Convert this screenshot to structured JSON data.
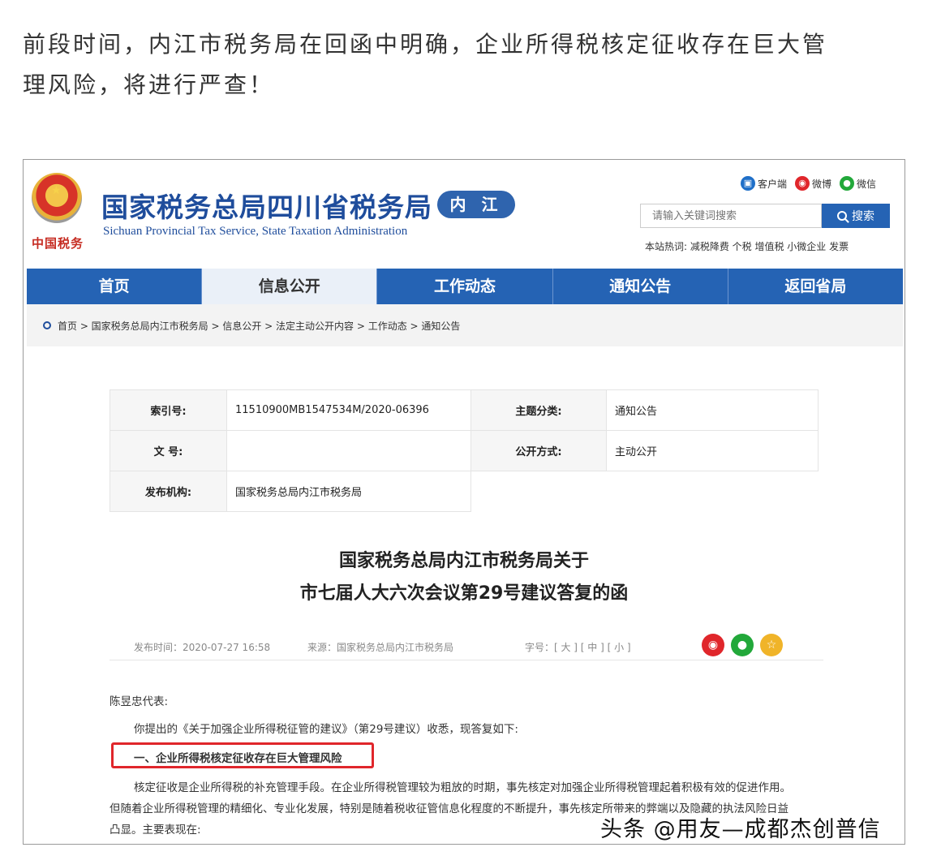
{
  "intro": {
    "line1": "前段时间，内江市税务局在回函中明确，企业所得税核定征收存在巨大管",
    "line2": "理风险，将进行严查！"
  },
  "header": {
    "emblem_text": "中国税务",
    "title": "国家税务总局四川省税务局",
    "city": "内 江",
    "subtitle": "Sichuan Provincial Tax Service, State Taxation Administration",
    "links": [
      {
        "label": "客户端",
        "icon": "client-icon",
        "color": "#1f6fc8"
      },
      {
        "label": "微博",
        "icon": "weibo-icon",
        "color": "#e0262b"
      },
      {
        "label": "微信",
        "icon": "wechat-icon",
        "color": "#22a83a"
      }
    ],
    "search_placeholder": "请输入关键词搜索",
    "search_label": "搜索",
    "hot_words": "本站热词:   减税降费 个税 增值税 小微企业 发票"
  },
  "nav": [
    "首页",
    "信息公开",
    "工作动态",
    "通知公告",
    "返回省局"
  ],
  "breadcrumb": "首页 > 国家税务总局内江市税务局 > 信息公开 > 法定主动公开内容 > 工作动态 > 通知公告",
  "meta": {
    "index_label": "索引号:",
    "index_value": "11510900MB1547534M/2020-06396",
    "topic_label": "主题分类:",
    "topic_value": "通知公告",
    "docno_label": "文 号:",
    "docno_value": "",
    "open_label": "公开方式:",
    "open_value": "主动公开",
    "org_label": "发布机构:",
    "org_value": "国家税务总局内江市税务局"
  },
  "doc": {
    "title_line1": "国家税务总局内江市税务局关于",
    "title_line2": "市七届人大六次会议第29号建议答复的函",
    "publish_time": "发布时间：2020-07-27 16:58",
    "source": "来源：国家税务总局内江市税务局",
    "font_size": "字号：[ 大 ] [ 中 ] [ 小 ]",
    "greeting": "陈昱忠代表:",
    "para1": "你提出的《关于加强企业所得税征管的建议》（第29号建议）收悉，现答复如下:",
    "heading1": "一、企业所得税核定征收存在巨大管理风险",
    "para2": "核定征收是企业所得税的补充管理手段。在企业所得税管理较为粗放的时期，事先核定对加强企业所得税管理起着积极有效的促进作用。",
    "para3": "但随着企业所得税管理的精细化、专业化发展，特别是随着税收征管信息化程度的不断提升，事先核定所带来的弊端以及隐藏的执法风险日益",
    "para4": "凸显。主要表现在:"
  },
  "watermark": "头条 @用友—成都杰创普信"
}
